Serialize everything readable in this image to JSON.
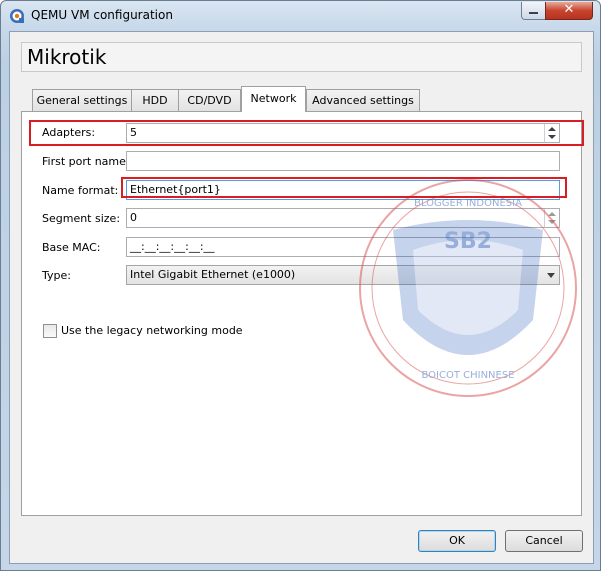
{
  "window": {
    "title": "QEMU VM configuration",
    "close_glyph": "✕",
    "icon": "qemu-app-icon"
  },
  "header": {
    "title": "Mikrotik"
  },
  "tabs": [
    {
      "label": "General settings",
      "active": false
    },
    {
      "label": "HDD",
      "active": false
    },
    {
      "label": "CD/DVD",
      "active": false
    },
    {
      "label": "Network",
      "active": true
    },
    {
      "label": "Advanced settings",
      "active": false
    }
  ],
  "network": {
    "adapters": {
      "label": "Adapters:",
      "value": "5"
    },
    "first_port_name": {
      "label": "First port name:",
      "value": ""
    },
    "name_format": {
      "label": "Name format:",
      "value": "Ethernet{port1}"
    },
    "segment_size": {
      "label": "Segment size:",
      "value": "0"
    },
    "base_mac": {
      "label": "Base MAC:",
      "value": "__:__:__:__:__:__"
    },
    "type": {
      "label": "Type:",
      "value": "Intel Gigabit Ethernet (e1000)"
    },
    "legacy_mode": {
      "label": "Use the legacy networking mode",
      "checked": false
    }
  },
  "watermark": {
    "top_text": "BLOGGER INDONESIA",
    "badge_text": "SB2",
    "bottom_text": "BOICOT CHINNESE",
    "color": "#2f5fb8",
    "ring_color": "#d94a4a"
  },
  "buttons": {
    "ok": "OK",
    "cancel": "Cancel"
  },
  "colors": {
    "highlight": "#d91d20",
    "accent": "#3c7fb1"
  }
}
